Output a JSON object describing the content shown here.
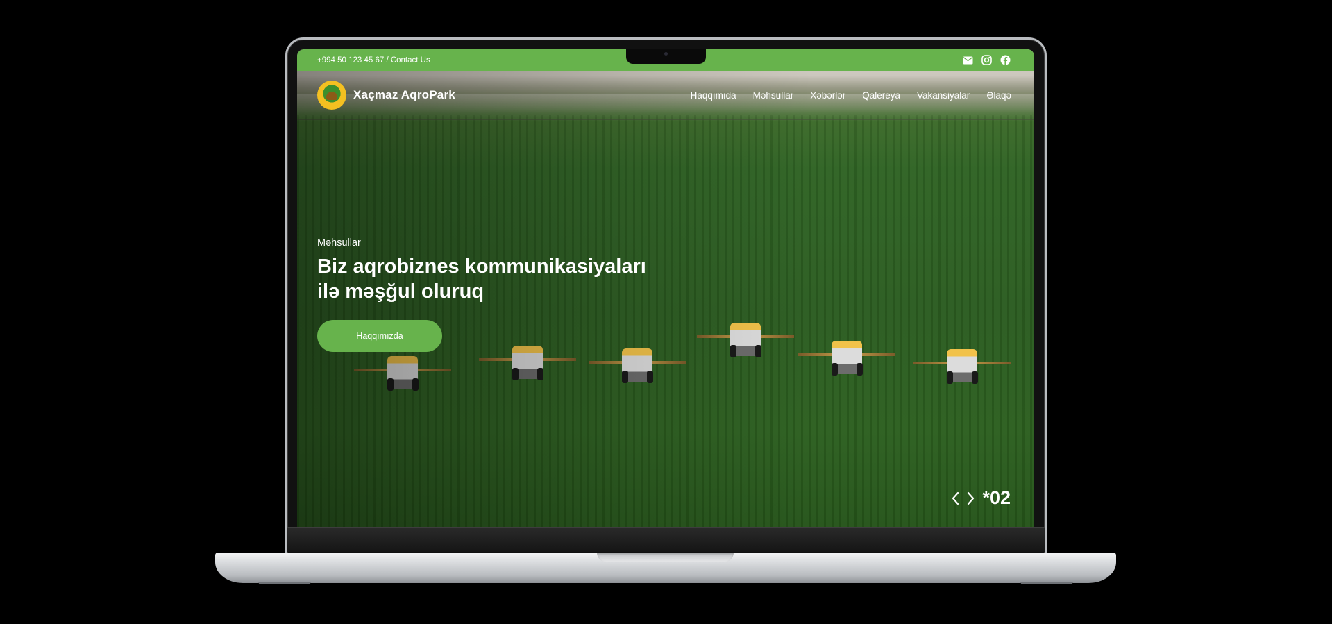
{
  "topbar": {
    "contact": "+994 50 123 45 67 / Contact Us",
    "icons": [
      "mail-icon",
      "instagram-icon",
      "facebook-icon"
    ]
  },
  "nav": {
    "brand": "Xaçmaz AqroPark",
    "items": [
      {
        "label": "Haqqımıda"
      },
      {
        "label": "Məhsullar"
      },
      {
        "label": "Xəbərlər"
      },
      {
        "label": "Qalereya"
      },
      {
        "label": "Vakansiyalar"
      },
      {
        "label": "Əlaqə"
      }
    ]
  },
  "hero": {
    "eyebrow": "Məhsullar",
    "headline_line1": "Biz aqrobiznes kommunikasiyaları",
    "headline_line2": "ilə məşğul oluruq",
    "cta": "Haqqımızda",
    "slide_counter": "*02"
  },
  "colors": {
    "accent": "#67b34c",
    "text": "#ffffff"
  }
}
